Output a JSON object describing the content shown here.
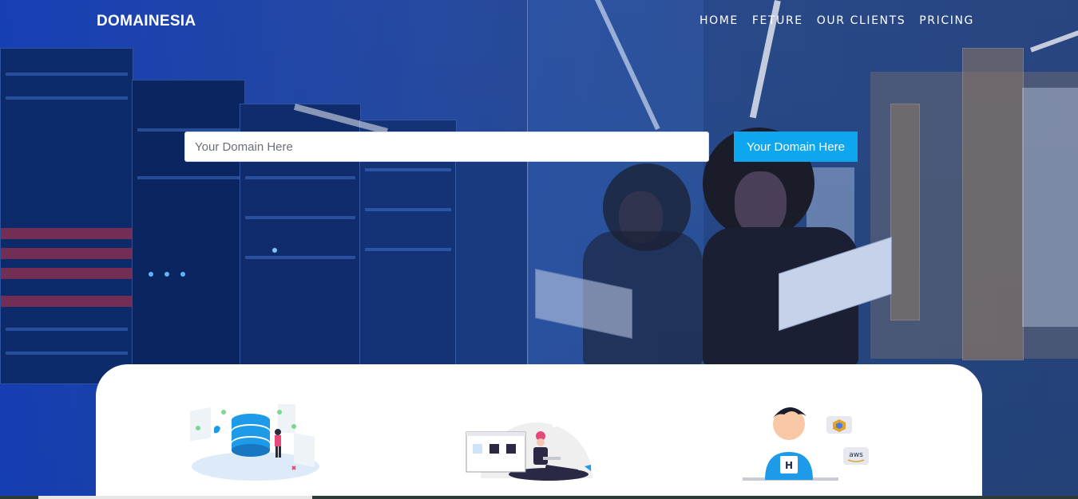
{
  "header": {
    "brand": "DOMAINESIA",
    "nav": [
      "HOME",
      "FETURE",
      "OUR CLIENTS",
      "PRICING"
    ]
  },
  "search": {
    "placeholder": "Your Domain Here",
    "button_label": "Your Domain Here"
  },
  "features": {
    "items": [
      {
        "icon": "database-illustration-icon"
      },
      {
        "icon": "person-with-browser-illustration-icon"
      },
      {
        "icon": "developer-cloud-illustration-icon",
        "badge_text": "aws"
      }
    ]
  },
  "colors": {
    "accent": "#0fa6f0",
    "overlay": "#1a47c8"
  }
}
